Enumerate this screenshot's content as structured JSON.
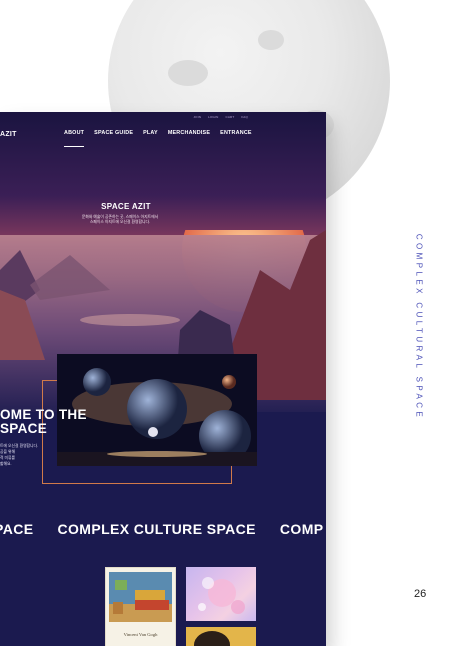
{
  "site": {
    "logo": "AZIT",
    "util_links": [
      "JOIN",
      "LOGIN",
      "CART",
      "FAQ"
    ],
    "nav": [
      "ABOUT",
      "SPACE GUIDE",
      "PLAY",
      "MERCHANDISE",
      "ENTRANCE"
    ],
    "hero_title": "SPACE AZIT",
    "hero_desc": "문화와 예술이 공존하는 곳, 스페이스 아지트에서\n스페이스 아지트에 오신걸 환영합니다.",
    "welcome_title": "OME TO THE\nSPACE",
    "welcome_sub": "트에 오신걸 환영합니다.\n공을 위해\n적 미류를\n할해요.",
    "marquee": [
      "PACE",
      "COMPLEX CULTURE SPACE",
      "COMP"
    ],
    "card_caption": "Vincent Van Gogh"
  },
  "side_text": "COMPLEX CULTURAL SPACE",
  "page_number": "26"
}
